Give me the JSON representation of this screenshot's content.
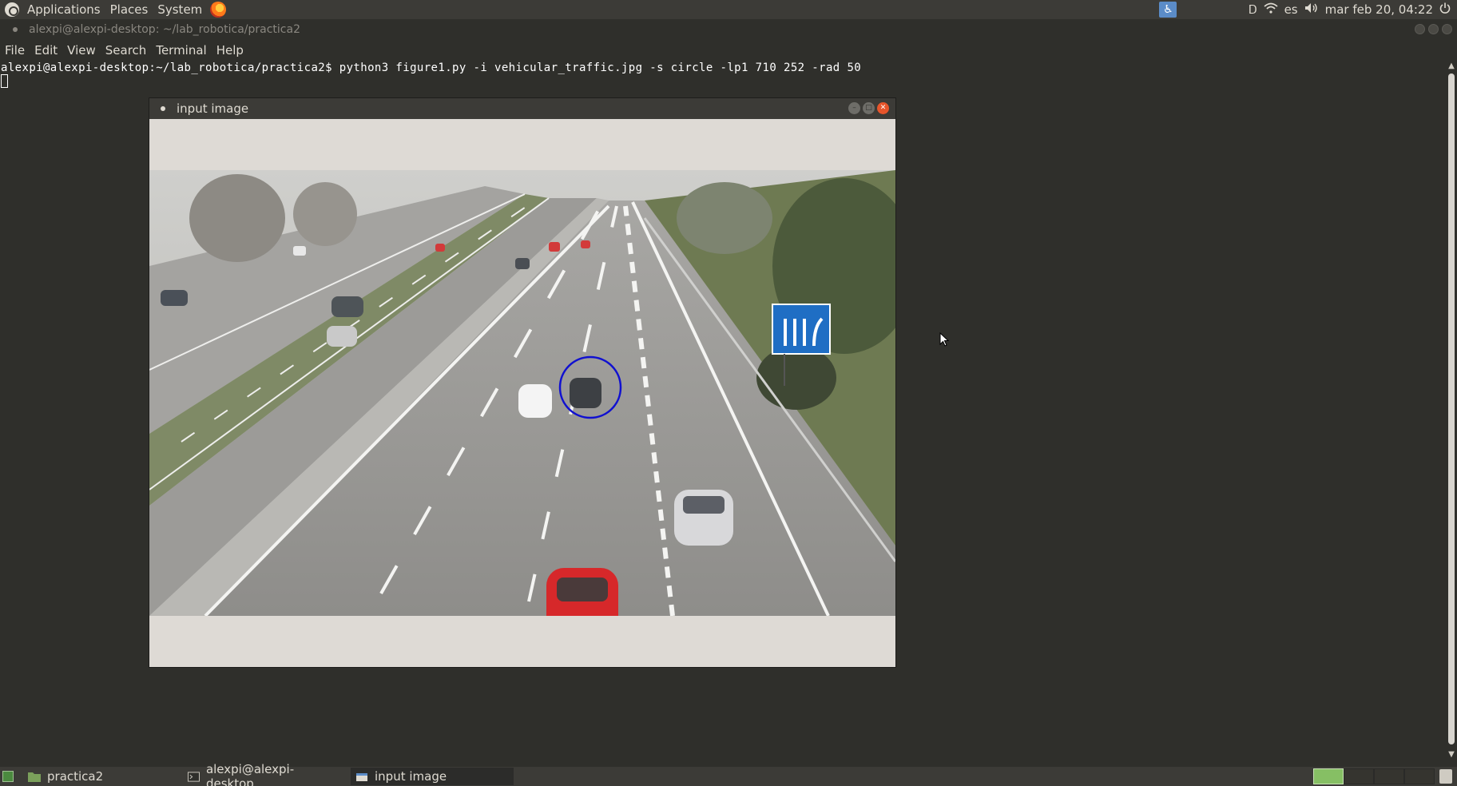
{
  "top_panel": {
    "applications": "Applications",
    "places": "Places",
    "system": "System",
    "keyboard_layout": "es",
    "clock": "mar feb 20, 04:22"
  },
  "terminal": {
    "title": "alexpi@alexpi-desktop: ~/lab_robotica/practica2",
    "menu": {
      "file": "File",
      "edit": "Edit",
      "view": "View",
      "search": "Search",
      "terminal": "Terminal",
      "help": "Help"
    },
    "command_line": "alexpi@alexpi-desktop:~/lab_robotica/practica2$ python3 figure1.py -i vehicular_traffic.jpg -s circle -lp1 710 252 -rad 50"
  },
  "image_window": {
    "title": "input image",
    "overlay_circle_color": "#1010d0"
  },
  "taskbar": {
    "tasks": [
      "practica2",
      "alexpi@alexpi-desktop...",
      "input image"
    ]
  },
  "colors": {
    "panel": "#3c3b37",
    "terminal_bg": "#2f2f2b",
    "close_button": "#e7552b",
    "workspace_active": "#86bf64"
  }
}
